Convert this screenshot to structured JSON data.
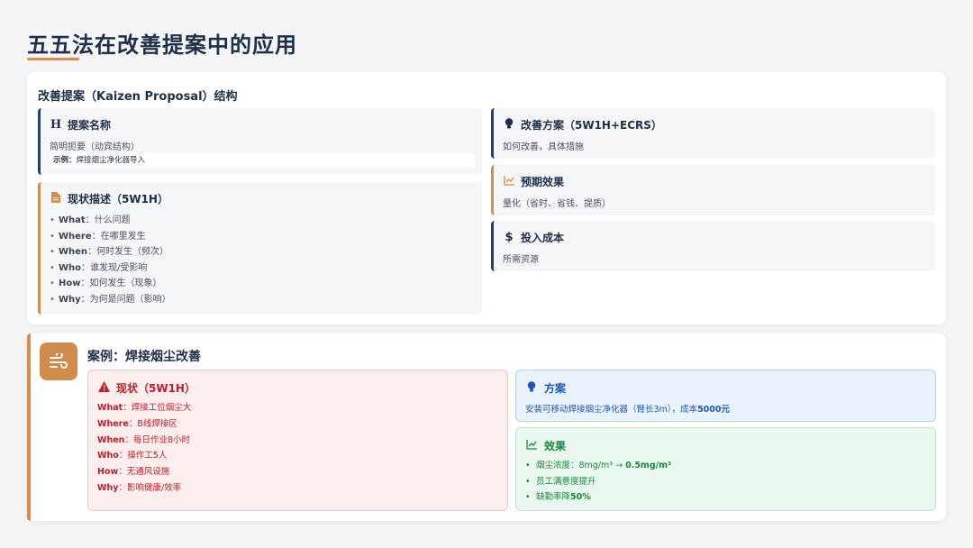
{
  "page": {
    "title": "五五法在改善提案中的应用"
  },
  "structure": {
    "heading": "改善提案（Kaizen Proposal）结构",
    "proposal_name": {
      "icon": "heading-icon",
      "title": "提案名称",
      "desc": "简明扼要（动宾结构）",
      "example_label": "示例：",
      "example_value": "焊接烟尘净化器导入"
    },
    "status": {
      "icon": "document-icon",
      "title": "现状描述（5W1H）",
      "items": [
        {
          "key": "What",
          "sep": "：",
          "value": "什么问题"
        },
        {
          "key": "Where",
          "sep": "：",
          "value": "在哪里发生"
        },
        {
          "key": "When",
          "sep": "：",
          "value": "何时发生（频次）"
        },
        {
          "key": "Who",
          "sep": "：",
          "value": "谁发现/受影响"
        },
        {
          "key": "How",
          "sep": "：",
          "value": "如何发生（现象）"
        },
        {
          "key": "Why",
          "sep": "：",
          "value": "为何是问题（影响）"
        }
      ]
    },
    "plan": {
      "icon": "lightbulb-icon",
      "title": "改善方案（5W1H+ECRS）",
      "desc": "如何改善，具体措施"
    },
    "effect": {
      "icon": "line-chart-icon",
      "title": "预期效果",
      "desc": "量化（省时、省钱、提质）"
    },
    "cost": {
      "icon": "dollar-icon",
      "title": "投入成本",
      "desc": "所需资源"
    }
  },
  "case": {
    "icon": "wind-icon",
    "title": "案例：焊接烟尘改善",
    "status": {
      "icon": "warning-icon",
      "title": "现状（5W1H）",
      "items": [
        {
          "key": "What",
          "sep": "：",
          "value": "焊接工位烟尘大"
        },
        {
          "key": "Where",
          "sep": "：",
          "value": "B线焊接区"
        },
        {
          "key": "When",
          "sep": "：",
          "value": "每日作业8小时"
        },
        {
          "key": "Who",
          "sep": "：",
          "value": "操作工5人"
        },
        {
          "key": "How",
          "sep": "：",
          "value": "无通风设施"
        },
        {
          "key": "Why",
          "sep": "：",
          "value": "影响健康/效率"
        }
      ]
    },
    "plan": {
      "icon": "lightbulb-icon",
      "title": "方案",
      "text": "安装可移动焊接烟尘净化器（臂长3m），成本",
      "cost_value": "5000元"
    },
    "effect": {
      "icon": "line-chart-icon",
      "title": "效果",
      "items": [
        {
          "prefix": "烟尘浓度：8mg/m³ → ",
          "strong": "0.5mg/m³",
          "suffix": ""
        },
        {
          "prefix": "员工满意度提升",
          "strong": "",
          "suffix": ""
        },
        {
          "prefix": "缺勤率降",
          "strong": "50%",
          "suffix": ""
        }
      ]
    }
  },
  "colors": {
    "navy": "#1f2f47",
    "accent_orange": "#d98b48",
    "red": "#c0202a",
    "blue": "#1d58b8",
    "green": "#178a3c"
  }
}
